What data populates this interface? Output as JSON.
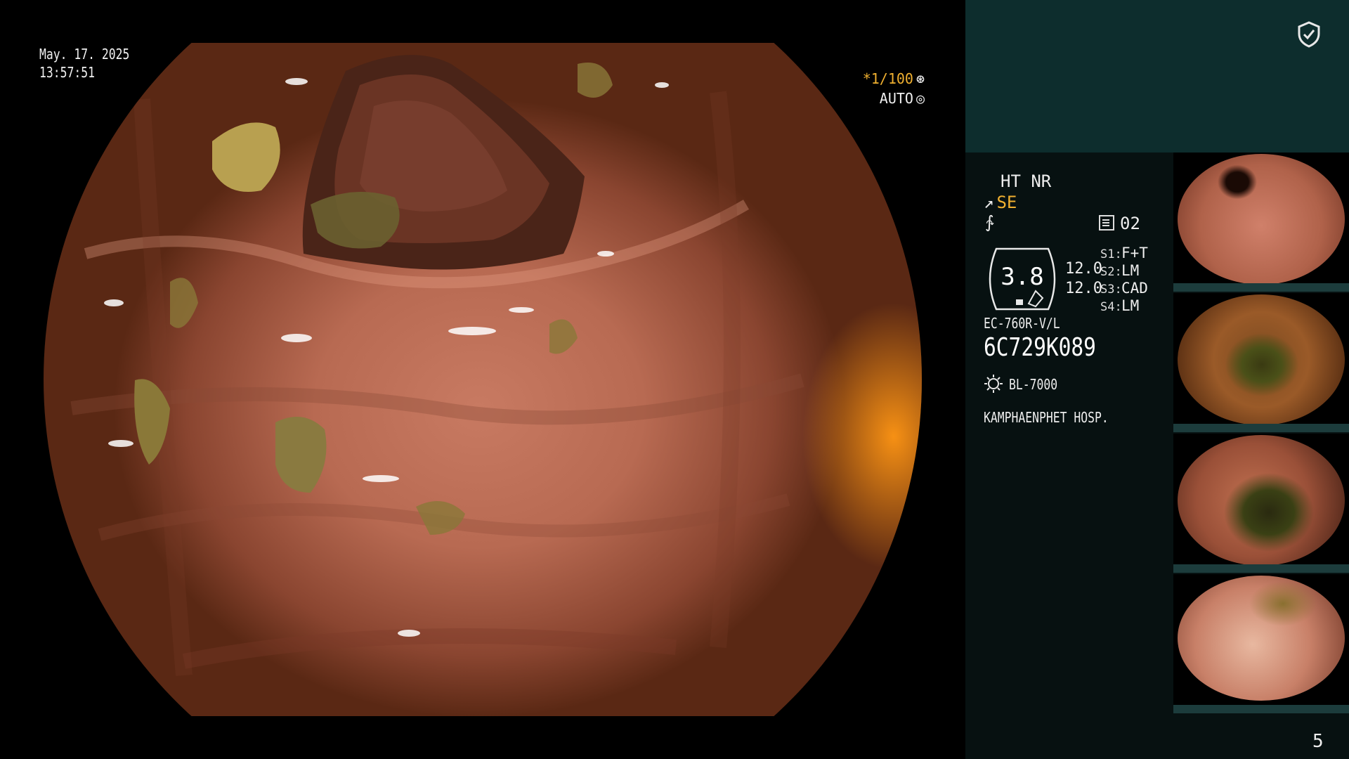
{
  "overlay": {
    "date": "May. 17. 2025",
    "time": "13:57:51",
    "shutter_speed": "*1/100",
    "iris_mode": "AUTO"
  },
  "panel": {
    "enhancement": "HT NR",
    "structure_mode": "SE",
    "memo_number": "02",
    "zoom_value": "3.8",
    "level_1": "12.0",
    "level_2": "12.0",
    "switches": [
      {
        "label": "S1:",
        "value": "F+T"
      },
      {
        "label": "S2:",
        "value": "LM"
      },
      {
        "label": "S3:",
        "value": "CAD"
      },
      {
        "label": "S4:",
        "value": "LM"
      }
    ],
    "scope_model": "EC-760R-V/L",
    "scope_serial": "6C729K089",
    "light_source": "BL-7000",
    "hospital": "KAMPHAENPHET HOSP."
  },
  "page_number": "5",
  "colors": {
    "panel_top": "#0d2d2d",
    "panel_bottom": "#071111",
    "accent": "#f0b030"
  },
  "icons": [
    "shield-check-icon",
    "iris-icon",
    "memo-icon",
    "lamp-icon"
  ]
}
